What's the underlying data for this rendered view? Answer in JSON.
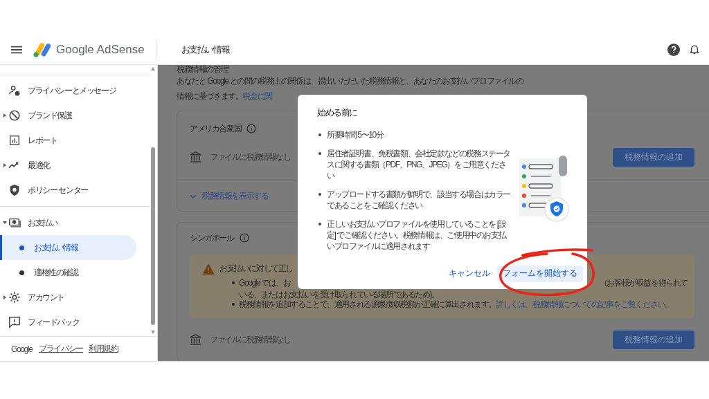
{
  "header": {
    "product": "Google AdSense",
    "page_title": "お支払い情報"
  },
  "sidebar": {
    "groups": [
      {
        "items": [
          {
            "label": "プライバシーとメッセージ"
          },
          {
            "label": "ブランド保護",
            "expanded": false
          },
          {
            "label": "レポート"
          },
          {
            "label": "最適化",
            "expanded": false
          },
          {
            "label": "ポリシー センター"
          }
        ]
      },
      {
        "items": [
          {
            "label": "お支払い",
            "expanded": true,
            "children": [
              {
                "label": "お支払い情報",
                "selected": true
              },
              {
                "label": "適格性の確認",
                "selected": false
              }
            ]
          },
          {
            "label": "アカウント",
            "expanded": false
          },
          {
            "label": "フィードバック"
          }
        ]
      }
    ],
    "footer": {
      "brand": "Google",
      "links": [
        "プライバシー",
        "利用規約"
      ]
    }
  },
  "content": {
    "heading": "税務情報の管理",
    "description": "あなたと Google との間の税務上の関係は、提出いただいた税務情報と、あなたのお支払いプロファイルの情報に基づきます。",
    "description_link": "税金に関",
    "us_card": {
      "title": "アメリカ合衆国",
      "status": "ファイルに税務情報なし",
      "button": "税務情報の追加",
      "expand_link": "税務情報を表示する"
    },
    "sg_card": {
      "title": "シンガポール",
      "warning": {
        "heading": "お支払いに対して正し",
        "bullet_1_start": "Google では、お",
        "bullet_1_end": "（お客様が収益を得られて",
        "bullet_1_cont": "いる、またはお支払いを受け取られている場所であるため)。",
        "bullet_2": "税務情報を追加することで、適用される源泉徴収税額が正確に算出されます。",
        "bullet_2_link": "詳しくは、税務情報についての記事をご覧ください。"
      },
      "status": "ファイルに税務情報なし",
      "button": "税務情報の追加"
    }
  },
  "dialog": {
    "title": "始める前に",
    "bullets": [
      "所要時間 5〜10分",
      "居住者証明書、免税書類、会社定款などの税務ステータスに関する書類（PDF、PNG、JPEG）をご用意ください",
      "アップロードする書類が鮮明で、該当する場合はカラーであることをご確認ください",
      "正しいお支払いプロファイルを使用していることを [設定] でご確認ください。税務情報は、ご使用中のお支払いプロファイルに適用されます"
    ],
    "cancel": "キャンセル",
    "confirm": "フォームを開始する"
  }
}
